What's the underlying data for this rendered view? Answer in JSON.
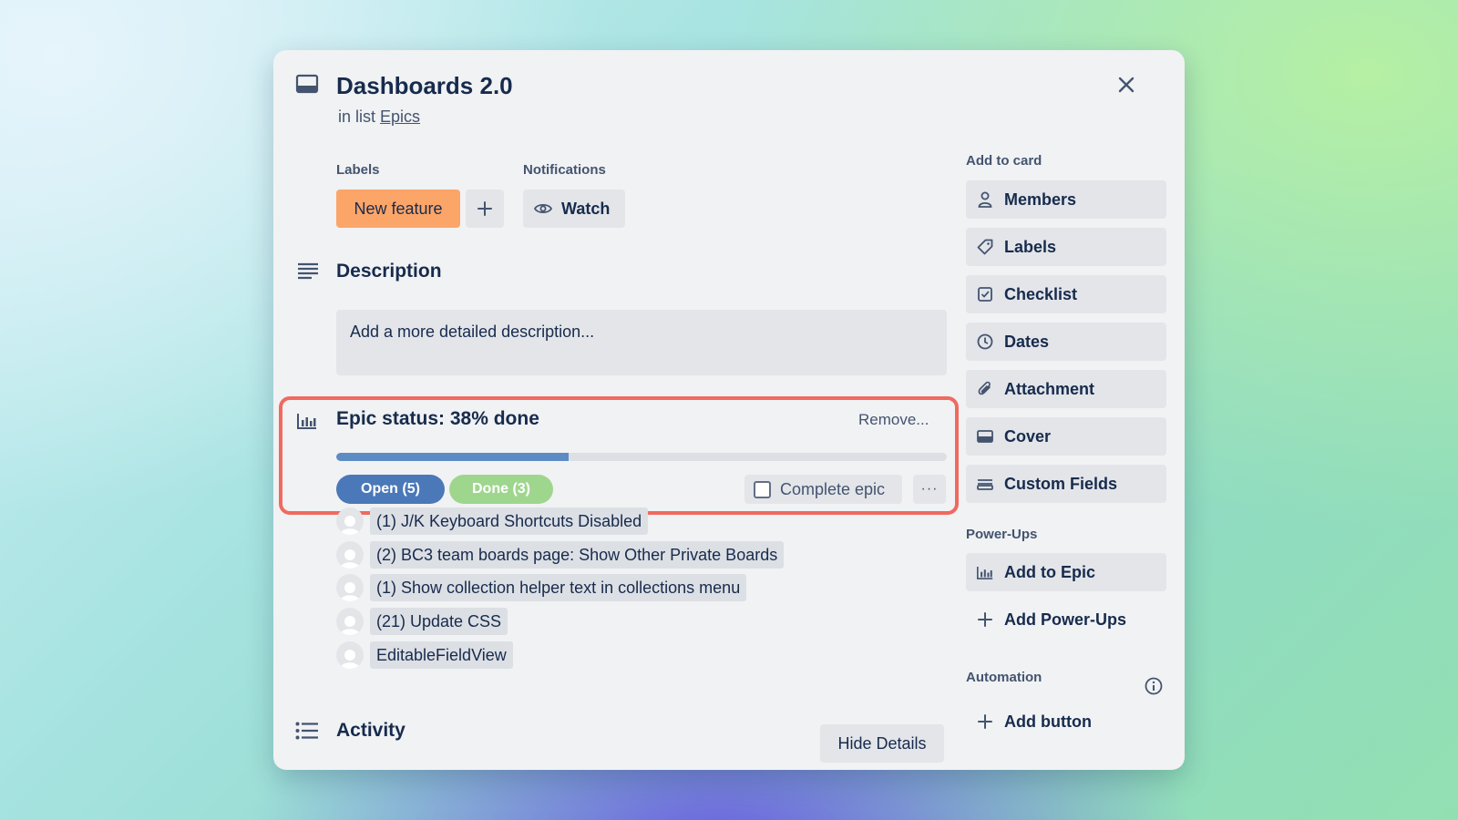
{
  "card": {
    "title": "Dashboards 2.0",
    "in_list_prefix": "in list",
    "list_name": "Epics"
  },
  "labels_section": {
    "heading": "Labels",
    "chip": "New feature",
    "chip_color": "#fca568"
  },
  "notifications": {
    "heading": "Notifications",
    "watch_label": "Watch"
  },
  "description": {
    "heading": "Description",
    "placeholder": "Add a more detailed description..."
  },
  "epic": {
    "title": "Epic status: 38% done",
    "percent_done": 38,
    "remove_label": "Remove...",
    "open_tab": "Open (5)",
    "done_tab": "Done (3)",
    "complete_label": "Complete epic",
    "more_label": "···",
    "tasks": [
      "(1) J/K Keyboard Shortcuts Disabled",
      "(2) BC3 team boards page: Show Other Private Boards",
      "(1) Show collection helper text in collections menu",
      "(21) Update CSS",
      "EditableFieldView"
    ]
  },
  "activity": {
    "heading": "Activity",
    "hide_details": "Hide Details"
  },
  "sidebar": {
    "add_to_card_heading": "Add to card",
    "add_to_card": [
      {
        "label": "Members",
        "icon": "person-icon"
      },
      {
        "label": "Labels",
        "icon": "tag-icon"
      },
      {
        "label": "Checklist",
        "icon": "checkbox-icon"
      },
      {
        "label": "Dates",
        "icon": "clock-icon"
      },
      {
        "label": "Attachment",
        "icon": "paperclip-icon"
      },
      {
        "label": "Cover",
        "icon": "cover-icon"
      },
      {
        "label": "Custom Fields",
        "icon": "custom-fields-icon"
      }
    ],
    "powerups_heading": "Power-Ups",
    "add_to_epic": "Add to Epic",
    "add_powerups": "Add Power-Ups",
    "automation_heading": "Automation",
    "add_button": "Add button"
  },
  "colors": {
    "highlight_border": "#f06a5f",
    "progress_fill": "#5d8cc5",
    "open_pill": "#4a78b8",
    "done_pill": "#9fd68e"
  }
}
